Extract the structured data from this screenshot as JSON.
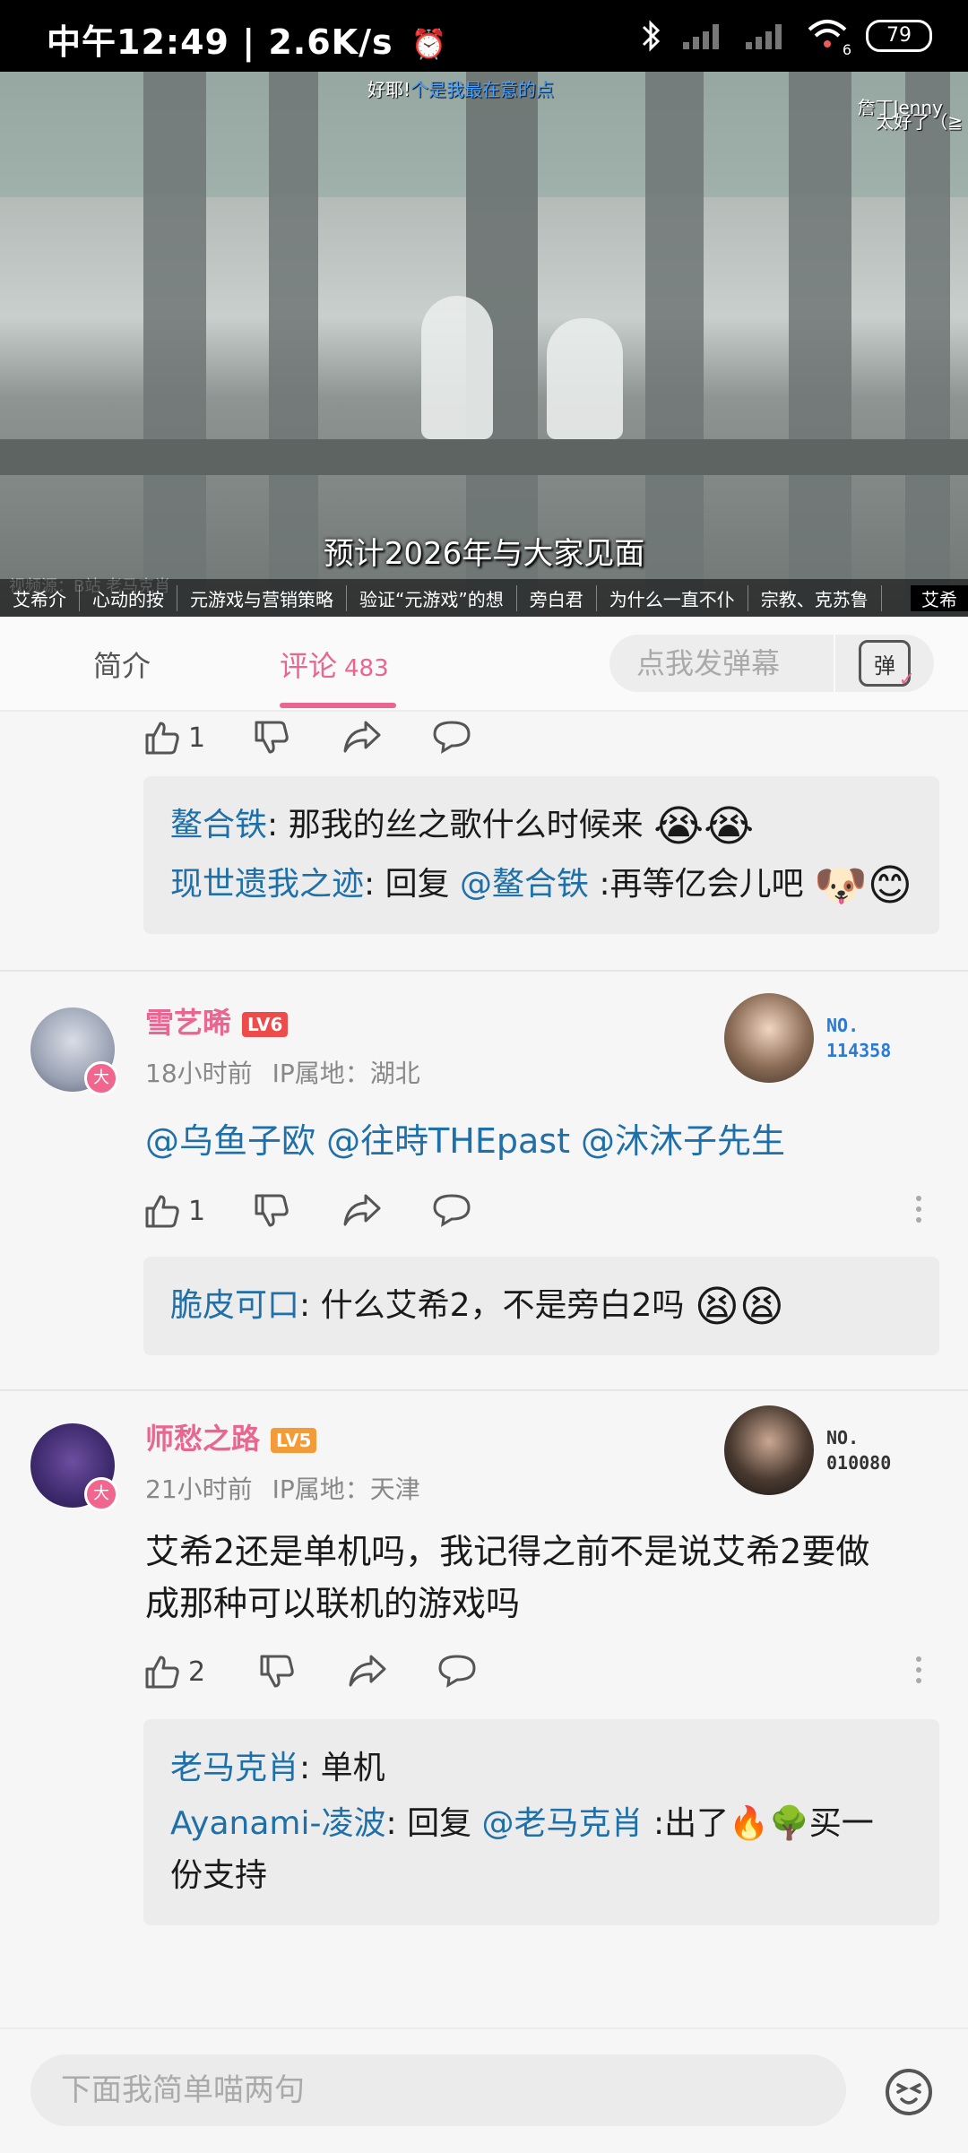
{
  "status_bar": {
    "time": "中午12:49",
    "speed": "2.6K/s",
    "battery": "79",
    "wifi_badge": "6"
  },
  "video": {
    "subtitle": "预计2026年与大家见面",
    "danmaku_top_plain": "好耶!",
    "danmaku_top_highlight": "个是我最在意的点",
    "watermark": "詹丁Jenny",
    "danmaku_right": "太好了（≧",
    "source_note": "视频源：B站 老马克肖",
    "chapters": [
      "艾希介",
      "心动的按",
      "元游戏与营销策略",
      "验证“元游戏”的想",
      "旁白君",
      "为什么一直不仆",
      "宗教、克苏鲁",
      "艾希"
    ]
  },
  "tabs": {
    "intro": "简介",
    "comments": "评论",
    "comments_count": "483",
    "danmu_placeholder": "点我发弹幕",
    "danmu_button": "弹"
  },
  "thread0": {
    "likes": "1",
    "replies": [
      {
        "name": "鳌合铁",
        "sep": ": ",
        "text": "那我的丝之歌什么时候来",
        "emoji": "😭😭"
      },
      {
        "name": "现世遗我之迹",
        "sep": ": ",
        "prefix": "回复 ",
        "mention": "@鳌合铁",
        "text": " :再等亿会儿吧",
        "emoji": "🐶😊"
      }
    ]
  },
  "comment1": {
    "username": "雪艺晞",
    "level": "LV6",
    "avatar_badge": "大",
    "time": "18小时前",
    "ip": "IP属地：湖北",
    "fan_no_label": "NO.",
    "fan_no": "114358",
    "mentions": "@乌鱼子欧 @往時THEpast @沐沐子先生",
    "likes": "1",
    "reply": {
      "name": "脆皮可口",
      "sep": ": ",
      "text": "什么艾希2，不是旁白2吗",
      "emoji": "😫😫"
    }
  },
  "comment2": {
    "username": "师愁之路",
    "level": "LV5",
    "avatar_badge": "大",
    "time": "21小时前",
    "ip": "IP属地：天津",
    "fan_no_label": "NO.",
    "fan_no": "010080",
    "text_line1": "艾希2还是单机吗，我记得之前不是说艾希2要做",
    "text_line2": "成那种可以联机的游戏吗",
    "likes": "2",
    "replies": [
      {
        "name": "老马克肖",
        "sep": ": ",
        "text": "单机"
      },
      {
        "name": "Ayanami-凌波",
        "sep": ": ",
        "prefix": "回复 ",
        "mention": "@老马克肖",
        "text": " :出了🔥🌳买一",
        "text2": "份支持"
      }
    ]
  },
  "bottom_input": {
    "placeholder": "下面我简单喵两句"
  },
  "colors": {
    "accent_pink": "#e8668f",
    "link_blue": "#1f6fa8",
    "lv6": "#ee4b4b",
    "lv5": "#f29b38"
  }
}
